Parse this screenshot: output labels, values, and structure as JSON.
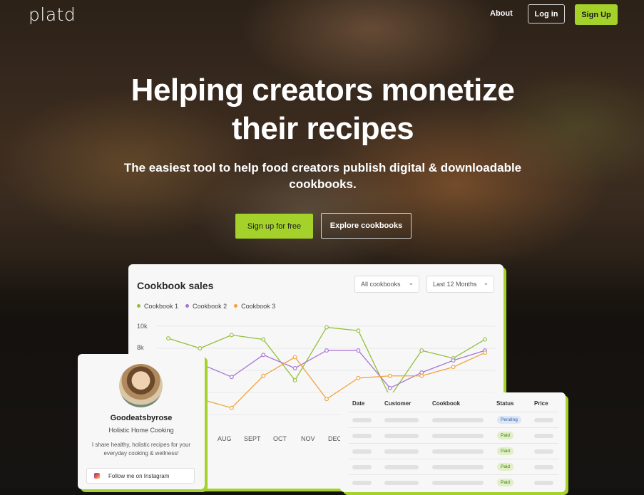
{
  "nav": {
    "logo": "platd",
    "about": "About",
    "login": "Log in",
    "signup": "Sign Up"
  },
  "hero": {
    "title": "Helping creators monetize their recipes",
    "subtitle": "The easiest tool to help food creators publish digital & downloadable cookbooks.",
    "cta_primary": "Sign up for free",
    "cta_secondary": "Explore cookbooks"
  },
  "colors": {
    "accent": "#a4d22b",
    "series1": "#92c03a",
    "series2": "#a874d6",
    "series3": "#f0a43b"
  },
  "sales_card": {
    "title": "Cookbook sales",
    "filter_cookbook": "All cookbooks",
    "filter_period": "Last 12 Months",
    "chevron_icon": "chevron-down-icon"
  },
  "chart_data": {
    "type": "line",
    "title": "Cookbook sales",
    "y_ticks": [
      "10k",
      "8k"
    ],
    "x_labels": [
      "AUG",
      "SEPT",
      "OCT",
      "NOV",
      "DEC"
    ],
    "x": [
      0,
      1,
      2,
      3,
      4,
      5,
      6,
      7,
      8,
      9,
      10
    ],
    "series": [
      {
        "name": "Cookbook 1",
        "color": "#92c03a",
        "values": [
          8.9,
          8.0,
          9.2,
          8.8,
          5.1,
          9.9,
          9.6,
          3.6,
          7.8,
          7.1,
          8.8
        ]
      },
      {
        "name": "Cookbook 2",
        "color": "#a874d6",
        "values": [
          3.9,
          6.6,
          5.4,
          7.4,
          6.2,
          7.8,
          7.8,
          4.4,
          5.8,
          6.9,
          7.8
        ]
      },
      {
        "name": "Cookbook 3",
        "color": "#f0a43b",
        "values": [
          5.2,
          3.4,
          2.6,
          5.5,
          7.2,
          3.4,
          5.3,
          5.5,
          5.5,
          6.3,
          7.6
        ]
      }
    ],
    "x_visible": [
      0,
      10
    ],
    "ylim": [
      2,
      10
    ],
    "grid": true,
    "legend_position": "top-left"
  },
  "profile": {
    "name": "Goodeatsbyrose",
    "tagline": "Holistic Home Cooking",
    "bio": "I share healthy, holistic recipes for your everyday cooking & wellness!",
    "instagram_button": "Follow me on Instagram",
    "instagram_icon": "instagram-icon"
  },
  "orders": {
    "headers": [
      "Date",
      "Customer",
      "Cookbook",
      "Status",
      "Price"
    ],
    "statuses": [
      "Pending",
      "Paid",
      "Paid",
      "Paid",
      "Paid"
    ]
  }
}
